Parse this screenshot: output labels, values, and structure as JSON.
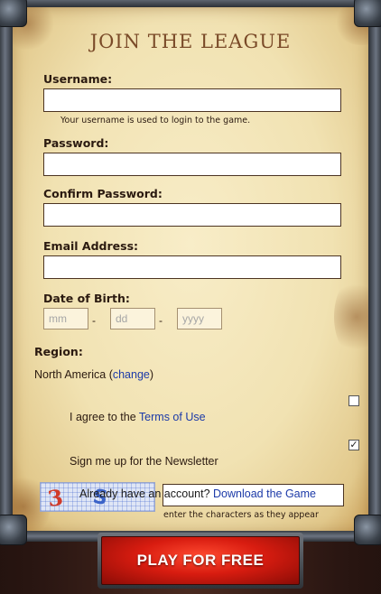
{
  "title": "JOIN THE LEAGUE",
  "username": {
    "label": "Username:",
    "value": "",
    "hint": "Your username is used to login to the game."
  },
  "password": {
    "label": "Password:",
    "value": ""
  },
  "confirm_password": {
    "label": "Confirm Password:",
    "value": ""
  },
  "email": {
    "label": "Email Address:",
    "value": ""
  },
  "dob": {
    "label": "Date of Birth:",
    "month_placeholder": "mm",
    "day_placeholder": "dd",
    "year_placeholder": "yyyy",
    "separator": "-"
  },
  "region": {
    "label": "Region:",
    "value": "North America",
    "open_paren": "(",
    "change_link": "change",
    "close_paren": ")"
  },
  "terms": {
    "text": "I agree to the",
    "link": "Terms of Use",
    "checked": false
  },
  "newsletter": {
    "text": "Sign me up for the Newsletter",
    "checked": true
  },
  "captcha": {
    "hint": "enter the characters as they appear",
    "value": ""
  },
  "already": {
    "text": "Already have an account?",
    "link": "Download the Game"
  },
  "play_button": "PLAY FOR FREE",
  "colors": {
    "link": "#1c3aa8",
    "button": "#d81c10",
    "title": "#7a4a28"
  }
}
